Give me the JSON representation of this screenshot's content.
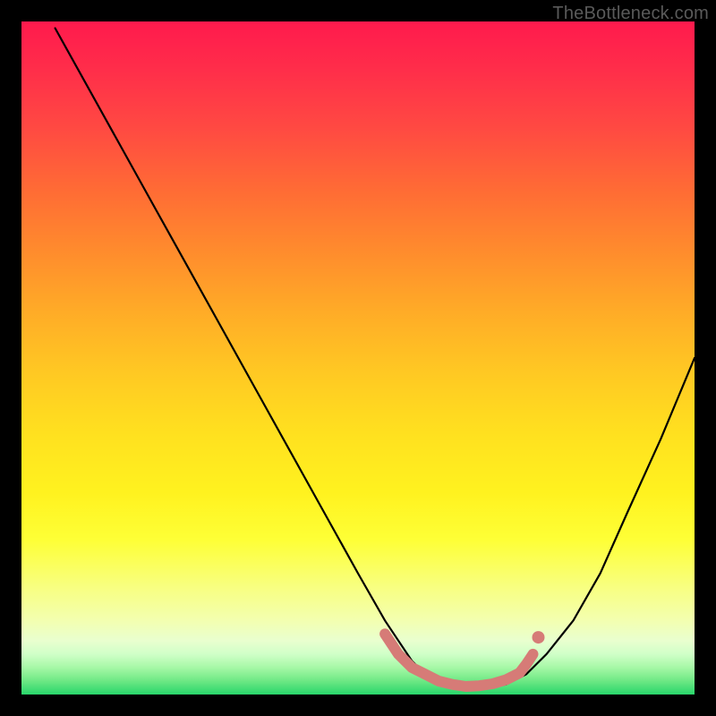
{
  "watermark": "TheBottleneck.com",
  "chart_data": {
    "type": "line",
    "title": "",
    "xlabel": "",
    "ylabel": "",
    "xlim": [
      0,
      100
    ],
    "ylim": [
      0,
      100
    ],
    "grid": false,
    "legend": false,
    "series": [
      {
        "name": "bottleneck-curve",
        "color": "#000000",
        "x": [
          5,
          10,
          15,
          20,
          25,
          30,
          35,
          40,
          45,
          50,
          54,
          56,
          58,
          60,
          63,
          66,
          69,
          72,
          75,
          78,
          82,
          86,
          90,
          95,
          100
        ],
        "y": [
          99,
          90,
          81,
          72,
          63,
          54,
          45,
          36,
          27,
          18,
          11,
          8,
          5,
          3,
          1.5,
          1,
          1,
          1.5,
          3,
          6,
          11,
          18,
          27,
          38,
          50
        ]
      },
      {
        "name": "highlight-bottom",
        "color": "#d67b77",
        "x": [
          54,
          56,
          58,
          60,
          62,
          64,
          66,
          68,
          70,
          72,
          74,
          75,
          76
        ],
        "y": [
          9,
          6,
          4,
          3,
          2,
          1.5,
          1.2,
          1.3,
          1.6,
          2.2,
          3.2,
          4.5,
          6
        ]
      }
    ]
  }
}
